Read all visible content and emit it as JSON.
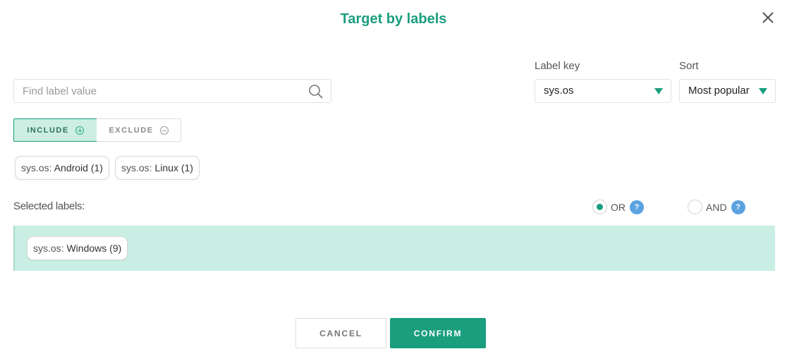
{
  "dialog": {
    "title": "Target by labels"
  },
  "search": {
    "placeholder": "Find label value",
    "value": ""
  },
  "label_key": {
    "label": "Label key",
    "value": "sys.os"
  },
  "sort": {
    "label": "Sort",
    "value": "Most popular"
  },
  "mode_toggle": {
    "include_label": "INCLUDE",
    "exclude_label": "EXCLUDE",
    "active": "include"
  },
  "available_labels": [
    {
      "key": "sys.os:",
      "value": "Android (1)"
    },
    {
      "key": "sys.os:",
      "value": "Linux (1)"
    }
  ],
  "selected": {
    "heading": "Selected labels:",
    "logic_or": "OR",
    "logic_and": "AND",
    "logic_value": "OR",
    "help_glyph": "?",
    "items": [
      {
        "key": "sys.os:",
        "value": "Windows (9)"
      }
    ]
  },
  "actions": {
    "cancel_label": "CANCEL",
    "confirm_label": "CONFIRM"
  },
  "colors": {
    "accent": "#1a9e7e",
    "selected_bg": "#c9eee3",
    "include_bg": "#cceee3",
    "help_blue": "#5ba3e0"
  },
  "icons": {
    "close": "close-icon",
    "search": "search-icon",
    "dropdown": "caret-down-icon",
    "include": "plus-circle-icon",
    "exclude": "minus-circle-icon",
    "help": "help-icon"
  }
}
